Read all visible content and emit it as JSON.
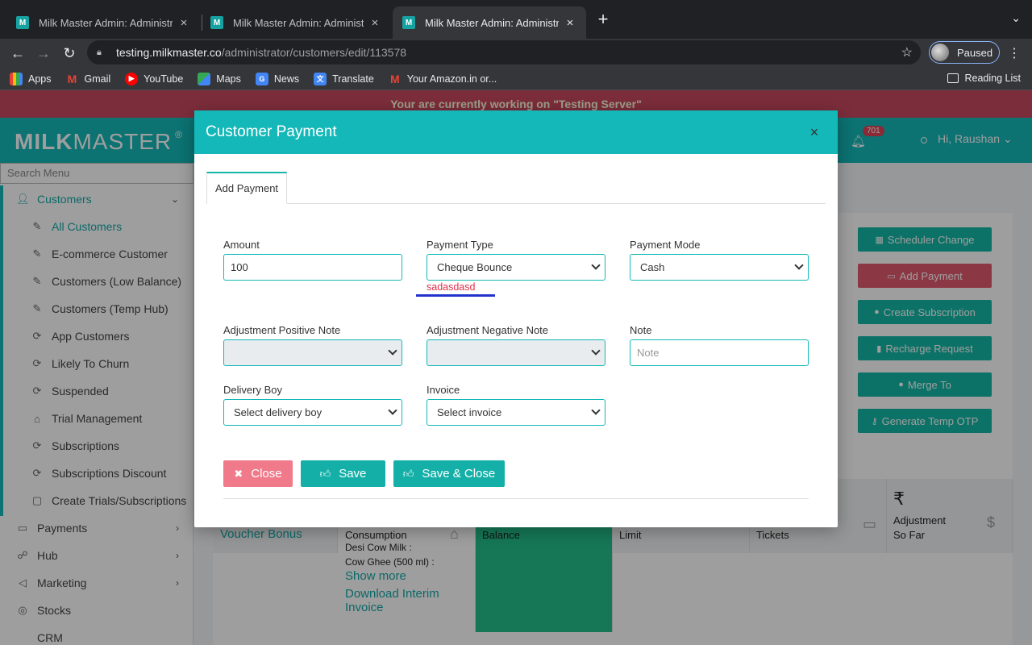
{
  "browser": {
    "tabs": [
      {
        "favicon": "M",
        "title": "Milk Master Admin: Administrat",
        "active": false
      },
      {
        "favicon": "M",
        "title": "Milk Master Admin: Administrat",
        "active": false
      },
      {
        "favicon": "M",
        "title": "Milk Master Admin: Administrat",
        "active": true
      }
    ],
    "url_host": "testing.milkmaster.co",
    "url_path": "/administrator/customers/edit/113578",
    "profile_label": "Paused",
    "bookmarks": [
      {
        "label": "Apps",
        "icon": "apps-icon"
      },
      {
        "label": "Gmail",
        "icon": "gmail-icon"
      },
      {
        "label": "YouTube",
        "icon": "youtube-icon"
      },
      {
        "label": "Maps",
        "icon": "maps-icon"
      },
      {
        "label": "News",
        "icon": "news-icon"
      },
      {
        "label": "Translate",
        "icon": "translate-icon"
      },
      {
        "label": "Your Amazon.in or...",
        "icon": "amazon-icon"
      }
    ],
    "reading_list": "Reading List"
  },
  "app": {
    "banner": "Your are currently working on \"Testing Server\"",
    "logo_bold": "MILK",
    "logo_light": "MASTER",
    "logo_mark": "®",
    "notification_count": "701",
    "user_greeting": "Hi, Raushan",
    "brand_color": "#14b8b8"
  },
  "sidebar": {
    "search_placeholder": "Search Menu",
    "group": "Customers",
    "sub_items": [
      "All Customers",
      "E-commerce Customer",
      "Customers (Low Balance)",
      "Customers (Temp Hub)",
      "App Customers",
      "Likely To Churn",
      "Suspended",
      "Trial Management",
      "Subscriptions",
      "Subscriptions Discount",
      "Create Trials/Subscriptions"
    ],
    "groups": [
      "Payments",
      "Hub",
      "Marketing",
      "Stocks",
      "CRM"
    ]
  },
  "actions": [
    {
      "label": "Scheduler Change",
      "icon": "calendar-icon"
    },
    {
      "label": "Add Payment",
      "icon": "card-icon"
    },
    {
      "label": "Create Subscription",
      "icon": "user-icon"
    },
    {
      "label": "Recharge Request",
      "icon": "mobile-icon"
    },
    {
      "label": "Merge To",
      "icon": "user-icon"
    },
    {
      "label": "Generate Temp OTP",
      "icon": "key-icon"
    }
  ],
  "stats": {
    "voucher_bonus": "Voucher Bonus",
    "consumption": "Consumption",
    "consumption_line1": "Desi Cow Milk :",
    "consumption_line2": "Cow Ghee (500 ml) :",
    "show_more": "Show more",
    "download_invoice": "Download Interim Invoice",
    "balance": "Balance",
    "limit": "Limit",
    "tickets": "Tickets",
    "rupee": "₹",
    "adjustment_line1": "Adjustment",
    "adjustment_line2": "So Far"
  },
  "modal": {
    "title": "Customer Payment",
    "tab": "Add Payment",
    "amount_label": "Amount",
    "amount_value": "100",
    "payment_type_label": "Payment Type",
    "payment_type_value": "Cheque Bounce",
    "payment_type_error": "sadasdasd",
    "payment_mode_label": "Payment Mode",
    "payment_mode_value": "Cash",
    "adj_pos_label": "Adjustment Positive Note",
    "adj_neg_label": "Adjustment Negative Note",
    "note_label": "Note",
    "note_placeholder": "Note",
    "delivery_boy_label": "Delivery Boy",
    "delivery_boy_value": "Select delivery boy",
    "invoice_label": "Invoice",
    "invoice_value": "Select invoice",
    "btn_close": "Close",
    "btn_save": "Save",
    "btn_save_close": "Save & Close"
  }
}
